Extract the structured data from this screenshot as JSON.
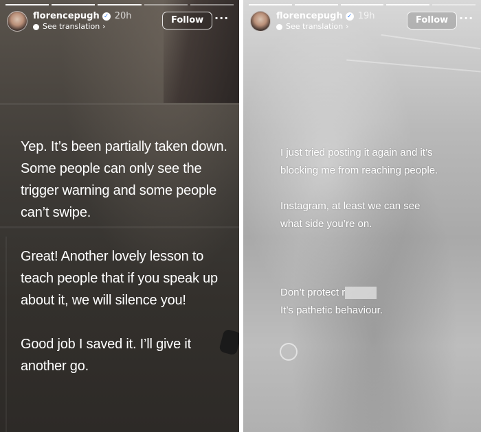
{
  "left_story": {
    "username": "florencepugh",
    "time": "20h",
    "translation": "See translation",
    "follow_label": "Follow",
    "more_label": "···",
    "paragraphs": [
      "Yep. It’s been partially taken down.\nSome people can only see the\ntrigger warning and some people\ncan’t swipe.",
      "Great! Another lovely lesson to\nteach people that if you speak up\nabout it, we will silence you!",
      "Good job I saved it. I’ll give it\nanother go."
    ]
  },
  "right_story": {
    "username": "florencepugh",
    "time": "19h",
    "translation": "See translation",
    "follow_label": "Follow",
    "more_label": "···",
    "paragraphs": [
      "I just tried posting it again and it’s\nblocking me from reaching people.",
      "Instagram, at least we can see\nwhat side you’re on."
    ],
    "final_line1": "Don’t protect r",
    "final_line2": "It’s pathetic behaviour."
  },
  "icons": {
    "verified": "verified-badge-icon",
    "translation": "globe-icon",
    "chevron": "chevron-right-icon",
    "more": "more-dots-icon"
  },
  "colors": {
    "left_background": "#3c3935",
    "right_background": "#b9b9b9",
    "verified_blue": "#3b82f6",
    "text": "#ffffff"
  }
}
